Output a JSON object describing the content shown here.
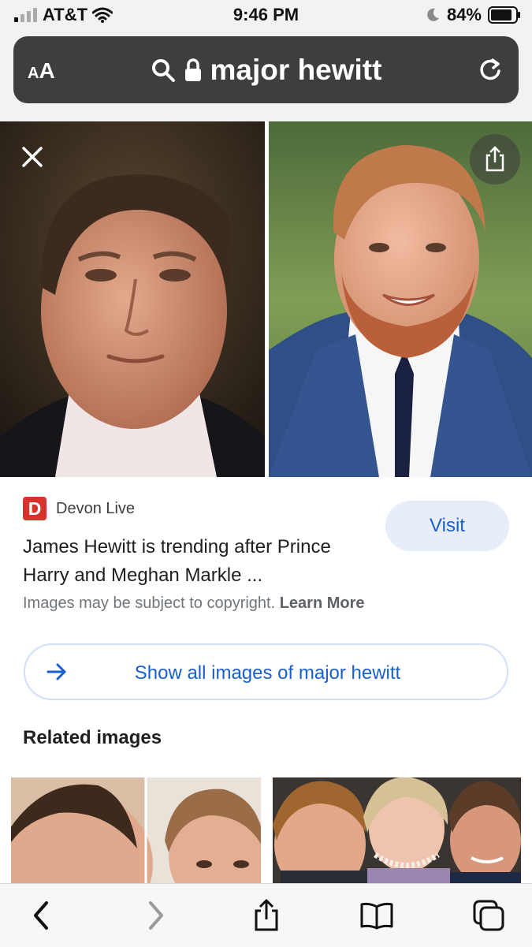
{
  "status": {
    "carrier": "AT&T",
    "time": "9:46 PM",
    "battery": "84%"
  },
  "url_bar": {
    "aa_small": "A",
    "aa_big": "A",
    "query": "major hewitt"
  },
  "result": {
    "source_logo": "D",
    "source_name": "Devon Live",
    "visit_label": "Visit",
    "title_line1": "James Hewitt is trending after Prince",
    "title_line2": "Harry and Meghan Markle ...",
    "copyright_text": "Images may be subject to copyright.",
    "learn_more": "Learn More"
  },
  "show_all": {
    "label": "Show all images of major hewitt"
  },
  "related": {
    "heading": "Related images"
  },
  "icons": {
    "signal": "signal-bars-icon",
    "wifi": "wifi-icon",
    "moon": "moon-icon",
    "battery": "battery-icon",
    "search": "search-icon",
    "lock": "lock-icon",
    "reload": "reload-icon",
    "close": "close-icon",
    "share": "share-icon",
    "arrow": "arrow-right-icon",
    "back": "chevron-left-icon",
    "forward": "chevron-right-icon",
    "bookmarks": "book-icon",
    "tabs": "tabs-icon"
  },
  "colors": {
    "accent": "#1a5fcf",
    "visit_bg": "#e7eef9",
    "source_logo": "#d8322c",
    "url_bar": "#3e3e3e"
  }
}
